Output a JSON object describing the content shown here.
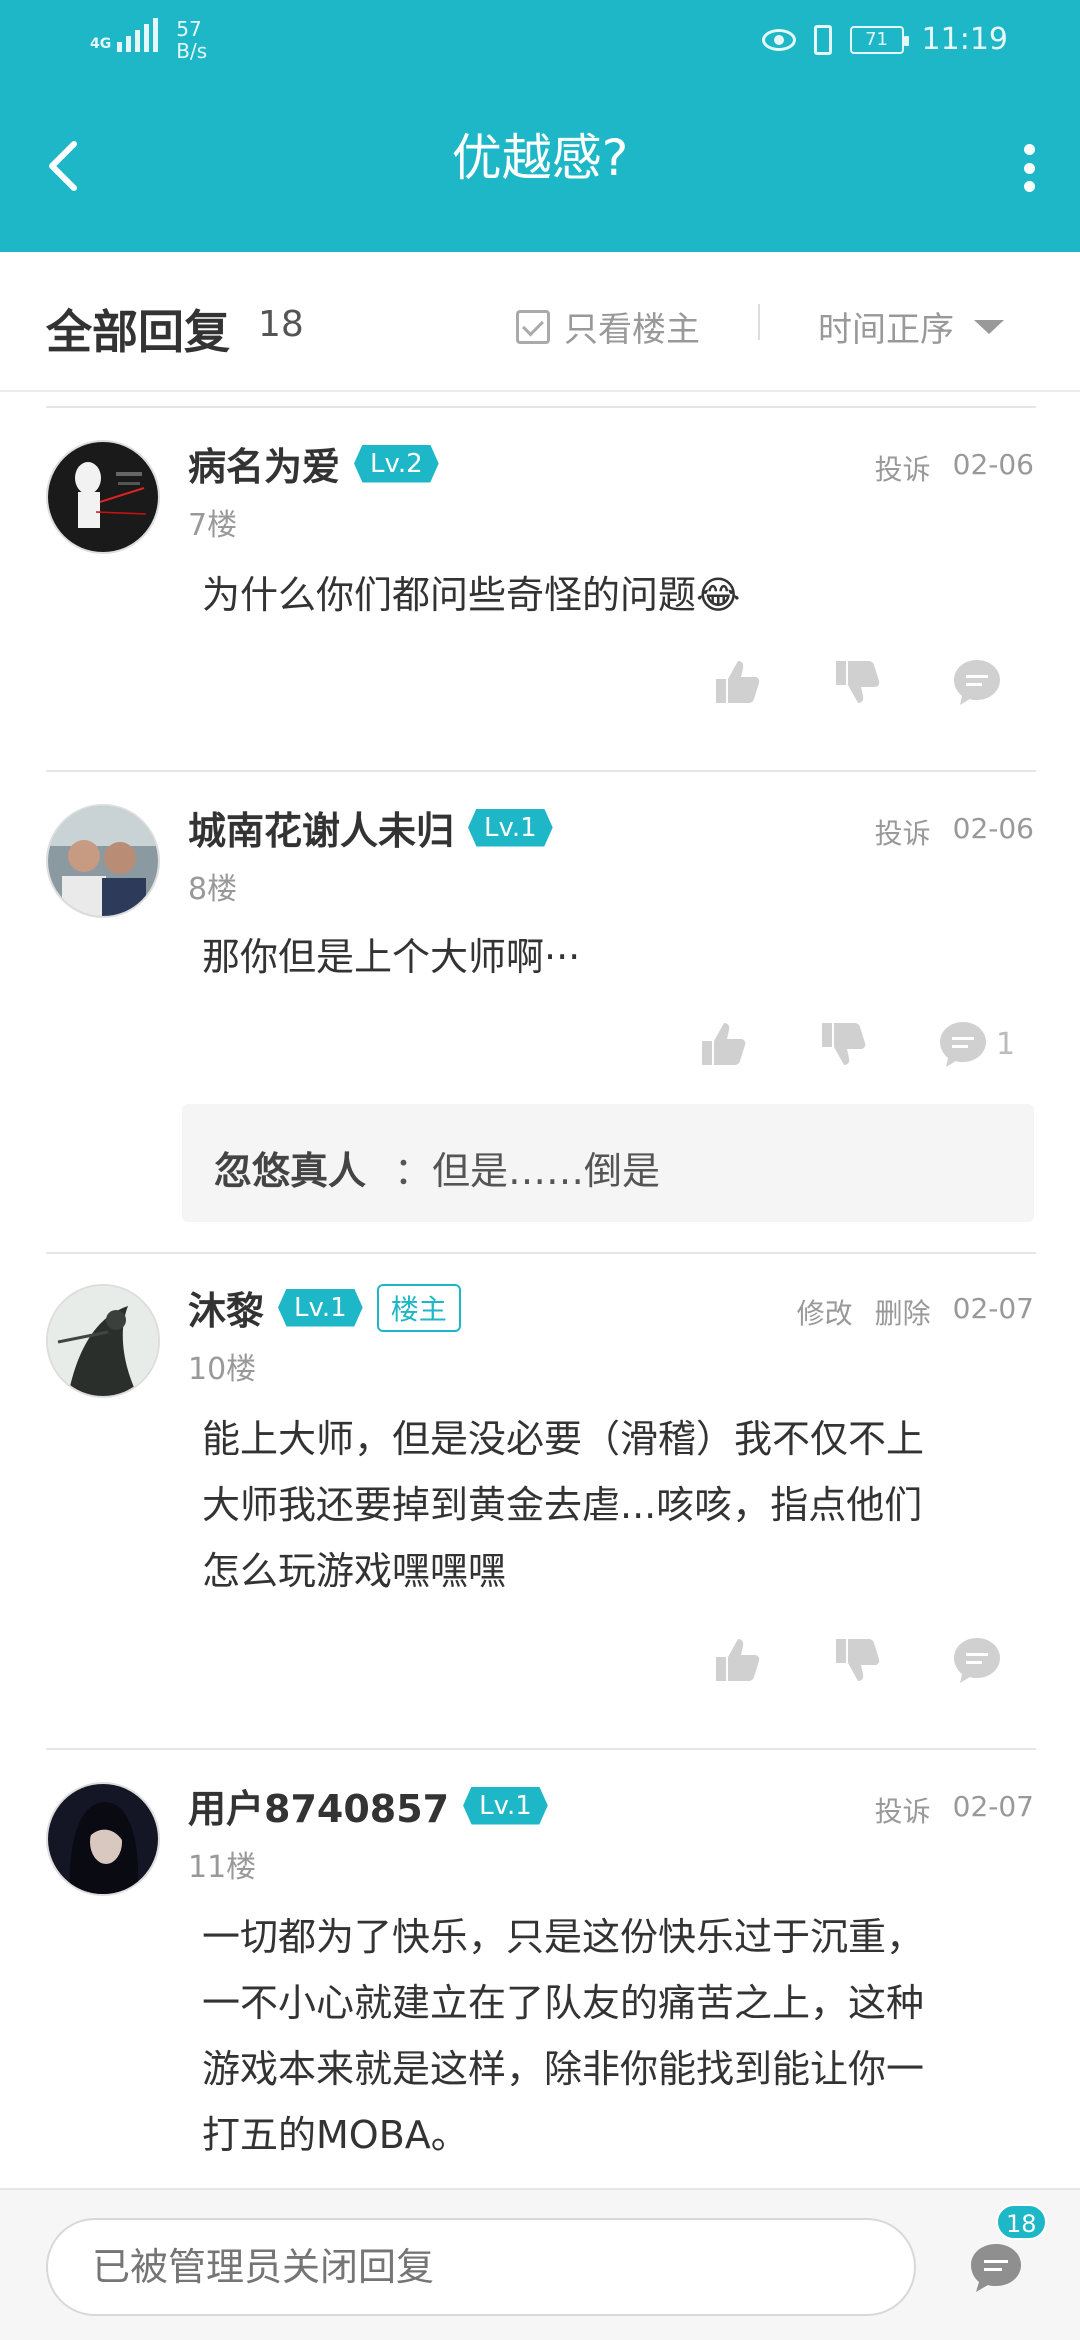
{
  "status_bar": {
    "network": "4G",
    "speed_value": "57",
    "speed_unit": "B/s",
    "battery": "71",
    "time": "11:19"
  },
  "header": {
    "title": "优越感?"
  },
  "replies_bar": {
    "title": "全部回复",
    "count": "18",
    "only_owner_label": "只看楼主",
    "sort_label": "时间正序"
  },
  "comments": [
    {
      "username": "病名为爱",
      "level": "Lv.2",
      "floor": "7楼",
      "action": "投诉",
      "date": "02-06",
      "text": "为什么你们都问些奇怪的问题😂"
    },
    {
      "username": "城南花谢人未归",
      "level": "Lv.1",
      "floor": "8楼",
      "action": "投诉",
      "date": "02-06",
      "text": "那你但是上个大师啊···",
      "comment_count": "1",
      "reply": {
        "name": "忽悠真人",
        "text": "：但是……倒是"
      }
    },
    {
      "username": "沐黎",
      "level": "Lv.1",
      "owner_tag": "楼主",
      "floor": "10楼",
      "action_edit": "修改",
      "action_delete": "删除",
      "date": "02-07",
      "lines": [
        "能上大师，但是没必要（滑稽）我不仅不上",
        "大师我还要掉到黄金去虐...咳咳，指点他们",
        "怎么玩游戏嘿嘿嘿"
      ]
    },
    {
      "username": "用户8740857",
      "level": "Lv.1",
      "floor": "11楼",
      "action": "投诉",
      "date": "02-07",
      "lines": [
        "一切都为了快乐，只是这份快乐过于沉重，",
        "一不小心就建立在了队友的痛苦之上，这种",
        "游戏本来就是这样，除非你能找到能让你一",
        "打五的MOBA。"
      ]
    }
  ],
  "bottom_bar": {
    "input_placeholder": "已被管理员关闭回复",
    "reply_count_badge": "18"
  },
  "colors": {
    "accent": "#1db7c7",
    "icon_gray": "#d0d0d0"
  }
}
